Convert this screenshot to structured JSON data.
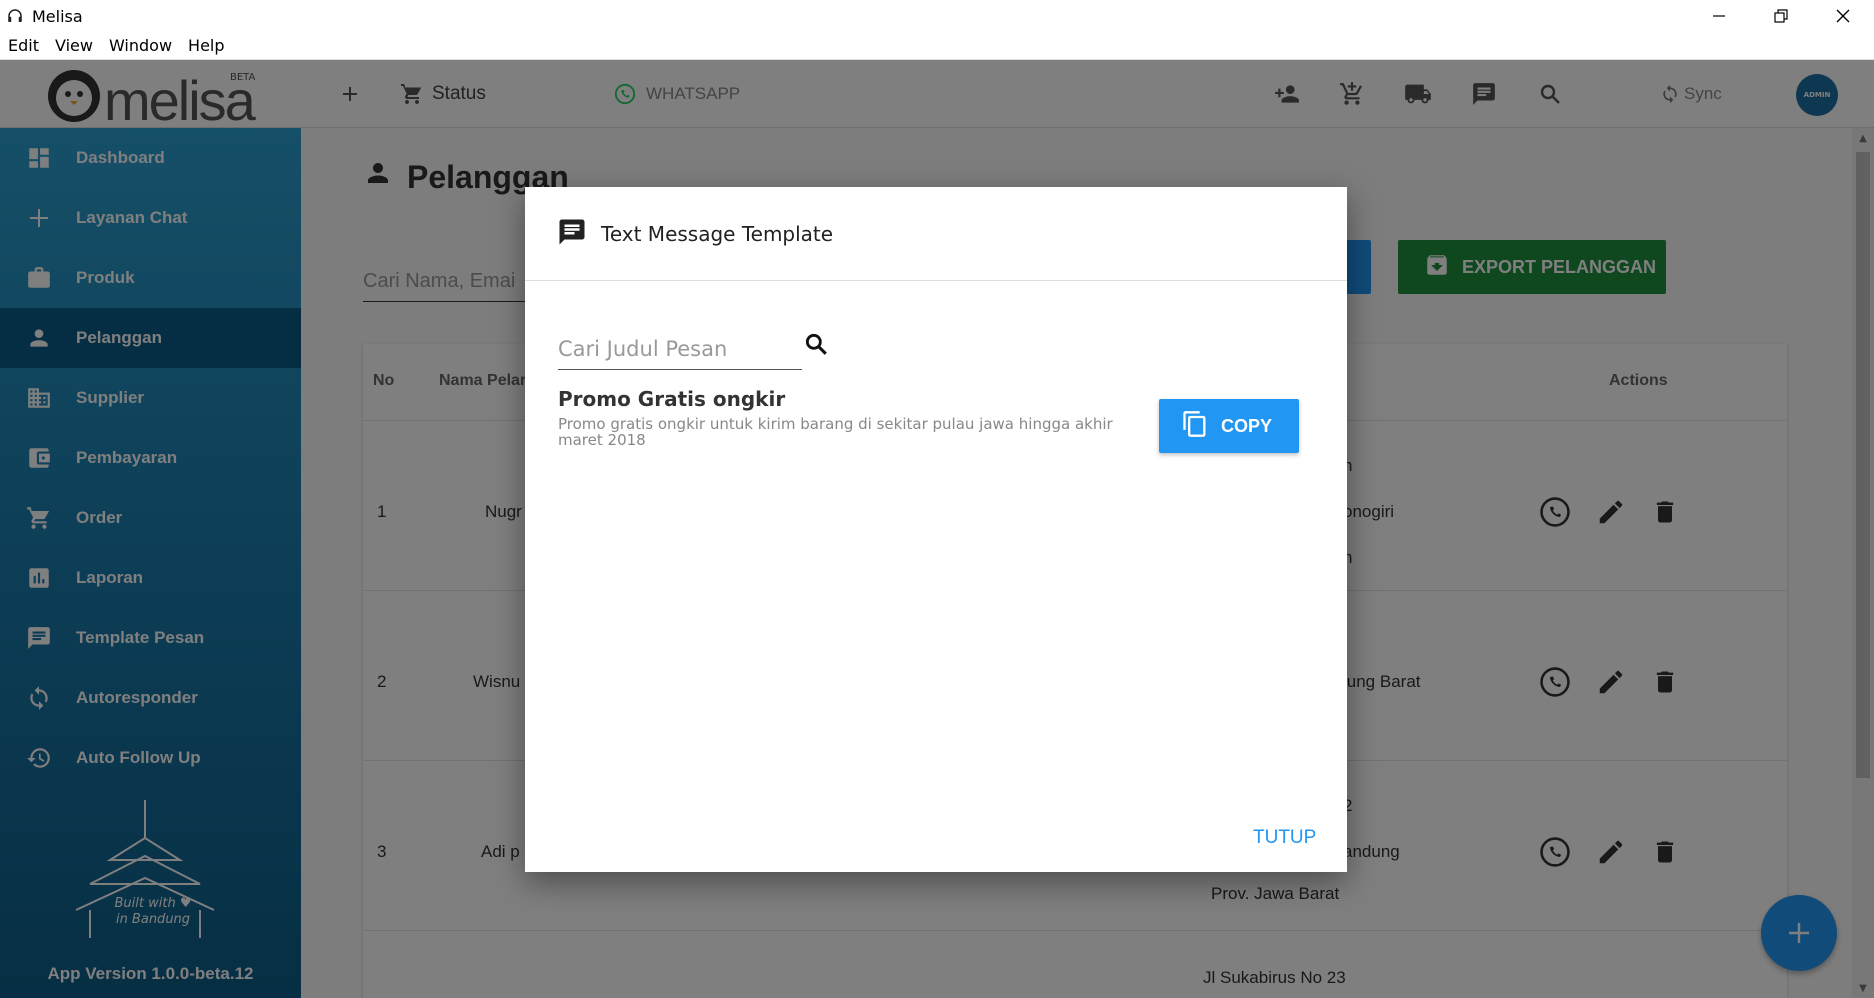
{
  "window": {
    "title": "Melisa"
  },
  "menu": [
    "Edit",
    "View",
    "Window",
    "Help"
  ],
  "header": {
    "logo_text": "melisa",
    "beta": "BETA",
    "status_label": "Status",
    "whatsapp_label": "WHATSAPP",
    "sync_label": "Sync",
    "avatar_text": "ADMIN"
  },
  "sidebar": {
    "items": [
      {
        "label": "Dashboard",
        "icon": "dashboard-icon"
      },
      {
        "label": "Layanan Chat",
        "icon": "plus-icon"
      },
      {
        "label": "Produk",
        "icon": "briefcase-icon"
      },
      {
        "label": "Pelanggan",
        "icon": "person-icon",
        "active": true
      },
      {
        "label": "Supplier",
        "icon": "building-icon"
      },
      {
        "label": "Pembayaran",
        "icon": "wallet-icon"
      },
      {
        "label": "Order",
        "icon": "cart-icon"
      },
      {
        "label": "Laporan",
        "icon": "chart-icon"
      },
      {
        "label": "Template Pesan",
        "icon": "message-icon"
      },
      {
        "label": "Autoresponder",
        "icon": "refresh-icon"
      },
      {
        "label": "Auto Follow Up",
        "icon": "history-icon"
      }
    ],
    "built_with": "Built with",
    "in_bandung": "in Bandung",
    "app_version": "App Version 1.0.0-beta.12"
  },
  "main": {
    "page_title": "Pelanggan",
    "search_placeholder": "Cari Nama, Emai",
    "export_label": "EXPORT PELANGGAN",
    "table": {
      "headers": {
        "no": "No",
        "nama": "Nama Pelar",
        "actions": "Actions"
      },
      "rows": [
        {
          "no": "1",
          "name": "Nugr",
          "addr1": "n",
          "addr2": "onogiri",
          "addr3": "n"
        },
        {
          "no": "2",
          "name": "Wisnu",
          "addr1": "",
          "addr2": "lung Barat",
          "addr3": ""
        },
        {
          "no": "3",
          "name": "Adi p",
          "addr1": "2",
          "addr2": "andung",
          "addr3": "Prov. Jawa Barat"
        }
      ],
      "partial_row_text": "Jl Sukabirus No 23"
    }
  },
  "dialog": {
    "title": "Text Message Template",
    "search_placeholder": "Cari Judul Pesan",
    "template": {
      "title": "Promo Gratis ongkir",
      "description": "Promo gratis ongkir untuk kirim barang di sekitar pulau jawa hingga akhir maret 2018"
    },
    "copy_label": "COPY",
    "close_label": "TUTUP"
  },
  "colors": {
    "primary": "#2196f3",
    "export_green": "#1e8e3e",
    "whatsapp": "#25d366",
    "sidebar_top": "#2c9fd0",
    "sidebar_bottom": "#0d5d88"
  }
}
